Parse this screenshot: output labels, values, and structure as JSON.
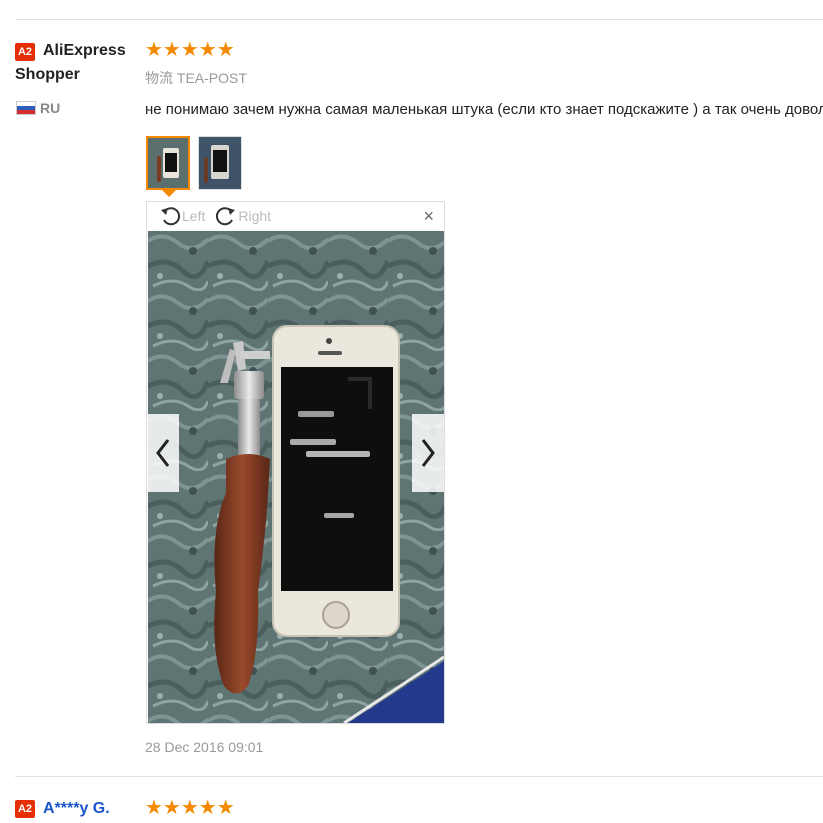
{
  "review1": {
    "badge": "A2",
    "name_line1": "AliExpress",
    "name_line2": "Shopper",
    "country_code": "RU",
    "flag_colors": [
      "#ffffff",
      "#2f5dbd",
      "#d62c2c"
    ],
    "rating": "★★★★★",
    "rating_value": 5,
    "logistics": "物流 TEA-POST",
    "text": "не понимаю зачем нужна самая маленькая штука (если кто знает подскажите ) а так очень доволен",
    "viewer": {
      "rotate_left_label": "Left",
      "rotate_right_label": "Right",
      "close_label": "×"
    },
    "date": "28 Dec 2016 09:01"
  },
  "review2": {
    "badge": "A2",
    "name": "A****y G.",
    "rating": "★★★★★",
    "rating_value": 5
  },
  "colors": {
    "badge": "#e62e04",
    "star": "#f58a00",
    "active_thumb": "#f58a00",
    "buyer_name_link": "#1a56c9"
  }
}
